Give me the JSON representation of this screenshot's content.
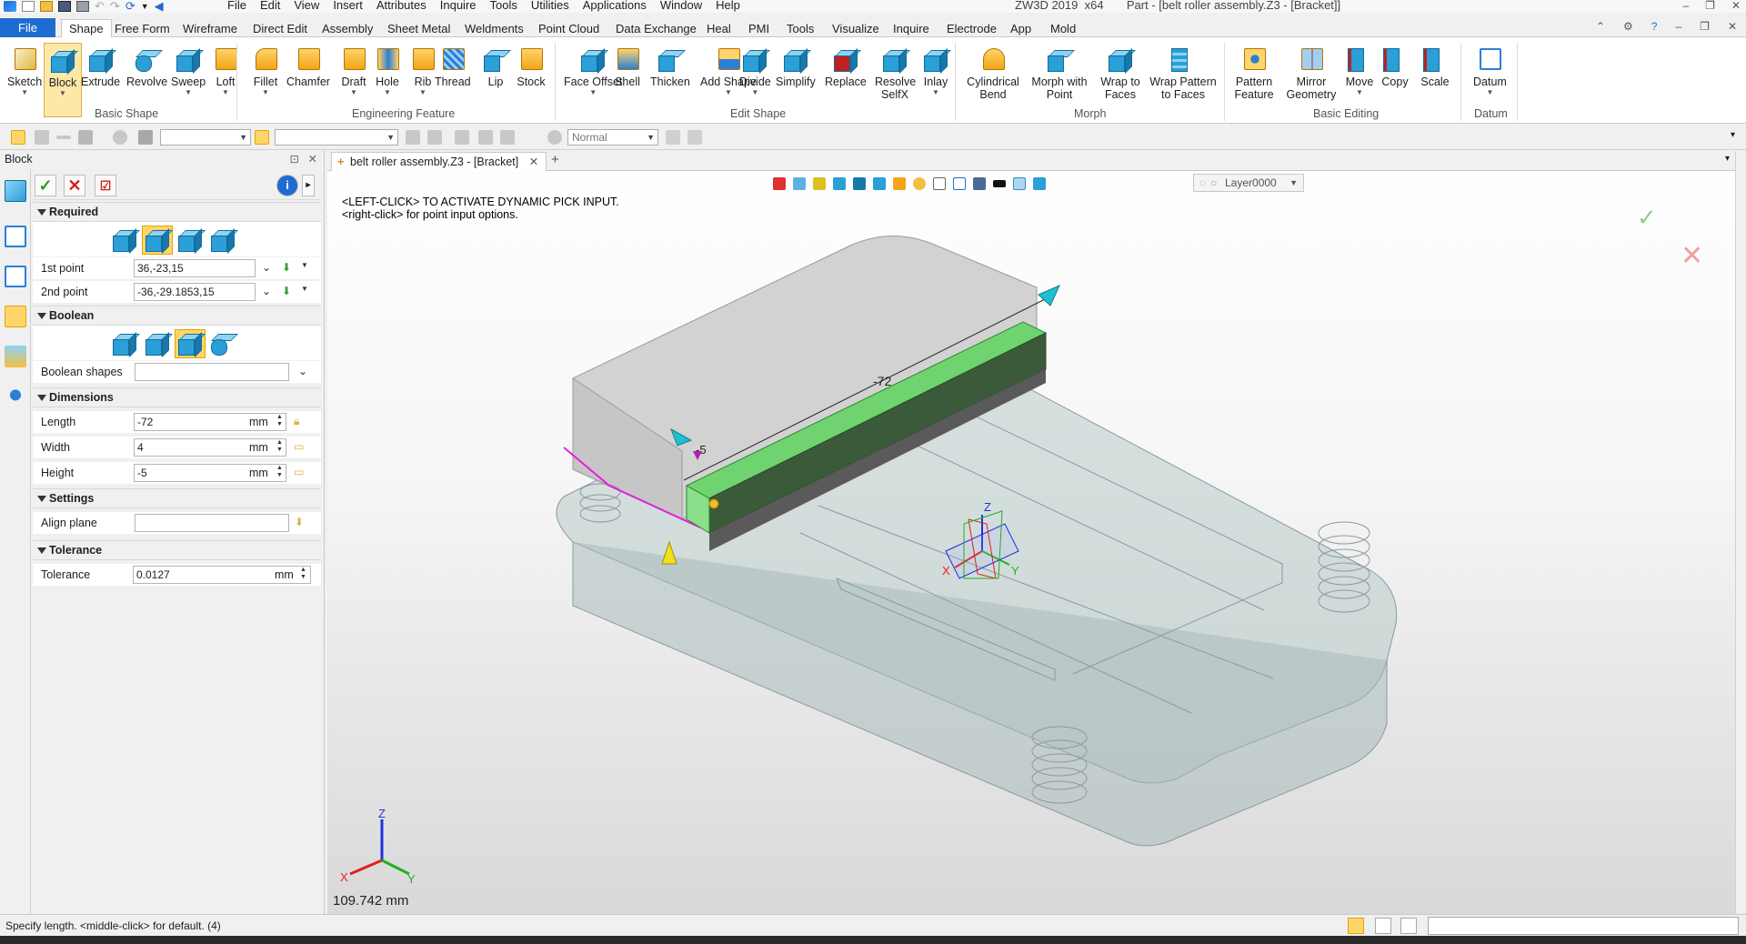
{
  "window": {
    "app": "ZW3D 2019",
    "arch": "x64",
    "title": "Part - [belt roller assembly.Z3 - [Bracket]]"
  },
  "menu": [
    "File",
    "Edit",
    "View",
    "Insert",
    "Attributes",
    "Inquire",
    "Tools",
    "Utilities",
    "Applications",
    "Window",
    "Help"
  ],
  "ribbon_tabs": [
    "File",
    "Shape",
    "Free Form",
    "Wireframe",
    "Direct Edit",
    "Assembly",
    "Sheet Metal",
    "Weldments",
    "Point Cloud",
    "Data Exchange",
    "Heal",
    "PMI",
    "Tools",
    "Visualize",
    "Inquire",
    "Electrode",
    "App",
    "Mold"
  ],
  "active_tab": "Shape",
  "ribbon": {
    "basic_shape": {
      "label": "Basic Shape",
      "buttons": [
        "Sketch",
        "Block",
        "Extrude",
        "Revolve",
        "Sweep",
        "Loft"
      ]
    },
    "engineering_feature": {
      "label": "Engineering Feature",
      "buttons": [
        "Fillet",
        "Chamfer",
        "Draft",
        "Hole",
        "Rib",
        "Thread",
        "Lip",
        "Stock"
      ]
    },
    "edit_shape": {
      "label": "Edit Shape",
      "buttons": [
        "Face Offset",
        "Shell",
        "Thicken",
        "Add Shape",
        "Divide",
        "Simplify",
        "Replace",
        "Resolve SelfX",
        "Inlay"
      ]
    },
    "morph": {
      "label": "Morph",
      "buttons": [
        "Cylindrical Bend",
        "Morph with Point",
        "Wrap to Faces",
        "Wrap Pattern to Faces"
      ]
    },
    "basic_editing": {
      "label": "Basic Editing",
      "buttons": [
        "Pattern Feature",
        "Mirror Geometry",
        "Move",
        "Copy",
        "Scale"
      ]
    },
    "datum": {
      "label": "Datum",
      "buttons": [
        "Datum"
      ]
    }
  },
  "toolbar": {
    "render_mode": "Normal",
    "filter_value": ""
  },
  "panel": {
    "title": "Block",
    "sections": {
      "required": "Required",
      "boolean": "Boolean",
      "dimensions": "Dimensions",
      "settings": "Settings",
      "tolerance": "Tolerance"
    },
    "first_point": {
      "label": "1st point",
      "value": "36,-23,15"
    },
    "second_point": {
      "label": "2nd point",
      "value": "-36,-29.1853,15"
    },
    "boolean_shapes": {
      "label": "Boolean shapes",
      "value": ""
    },
    "length": {
      "label": "Length",
      "value": "-72",
      "unit": "mm"
    },
    "width": {
      "label": "Width",
      "value": "4",
      "unit": "mm"
    },
    "height": {
      "label": "Height",
      "value": "-5",
      "unit": "mm"
    },
    "align_plane": {
      "label": "Align plane",
      "value": ""
    },
    "tolerance": {
      "label": "Tolerance",
      "value": "0.0127",
      "unit": "mm"
    }
  },
  "document_tab": "belt roller assembly.Z3 - [Bracket]",
  "viewport": {
    "hint1": "<LEFT-CLICK> TO ACTIVATE DYNAMIC PICK INPUT.",
    "hint2": "<right-click> for point input options.",
    "layer": "Layer0000",
    "dim_length": "-72",
    "dim_height": "-5",
    "distance": "109.742 mm",
    "axis_x": "X",
    "axis_y": "Y",
    "axis_z": "Z"
  },
  "status": {
    "message": "Specify length. <middle-click> for default. (4)"
  },
  "colors": {
    "accent": "#1e6bd1",
    "selected": "#ffd56b",
    "preview_green": "#5fd35f",
    "edge_magenta": "#e020e0"
  }
}
